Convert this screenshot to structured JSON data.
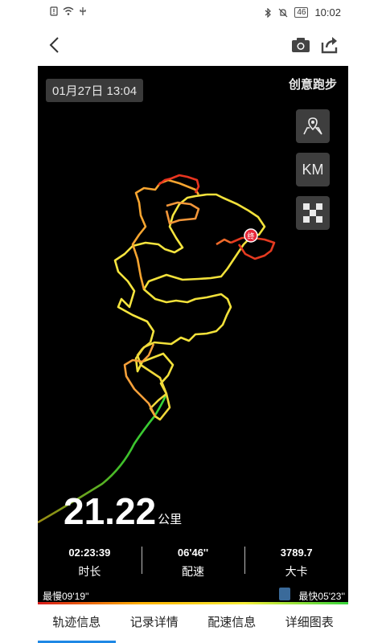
{
  "status_bar": {
    "time": "10:02",
    "battery": "46",
    "left_icons": [
      "sim-alert-icon",
      "wifi-icon",
      "usb-icon"
    ],
    "right_icons": [
      "bluetooth-icon",
      "mute-icon",
      "battery-icon"
    ]
  },
  "nav": {
    "back_icon": "chevron-left-icon",
    "camera_icon": "camera-icon",
    "share_icon": "share-icon"
  },
  "map": {
    "date": "01月27日 13:04",
    "brand": "创意跑步",
    "buttons": {
      "map_style_icon": "map-pin-icon",
      "unit_label": "KM",
      "checker_icon": "checker-icon"
    },
    "end_marker": "终"
  },
  "summary": {
    "distance_value": "21.22",
    "distance_unit": "公里",
    "stats": [
      {
        "value": "02:23:39",
        "label": "时长"
      },
      {
        "value": "06'46''",
        "label": "配速"
      },
      {
        "value": "3789.7",
        "label": "大卡"
      }
    ],
    "pace_slow": "最慢09'19''",
    "pace_fast": "最快05'23''"
  },
  "colors": {
    "accent": "#1e88e5",
    "map_bg": "#000000",
    "track_slow": "#d81b1b",
    "track_mid": "#ffb300",
    "track_fast": "#35d43a"
  },
  "tabs": [
    {
      "label": "轨迹信息",
      "active": true
    },
    {
      "label": "记录详情",
      "active": false
    },
    {
      "label": "配速信息",
      "active": false
    },
    {
      "label": "详细图表",
      "active": false
    }
  ]
}
